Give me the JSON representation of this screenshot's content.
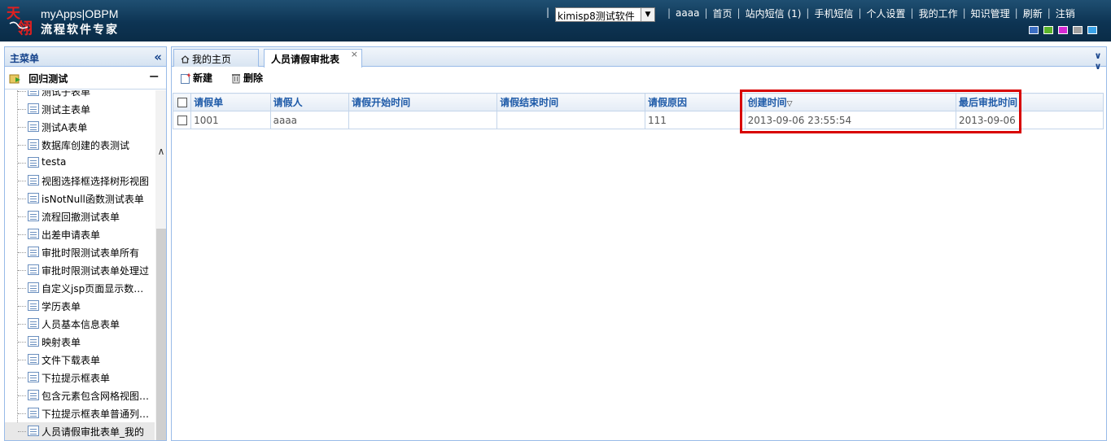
{
  "header": {
    "brand_en": "myApps|OBPM",
    "brand_cn": "流程软件专家",
    "logo_text": "天翎",
    "app_select_value": "kimisp8测试软件",
    "user": "aaaa",
    "links": [
      "首页",
      "站内短信 (1)",
      "手机短信",
      "个人设置",
      "我的工作",
      "知识管理",
      "刷新",
      "注销"
    ],
    "skin_colors": [
      "#3c6fc4",
      "#5ab32b",
      "#d42ad4",
      "#a0a0a0",
      "#3aa3e8"
    ]
  },
  "sidebar": {
    "title": "主菜单",
    "group": "回归测试",
    "items": [
      "测试子表单",
      "测试主表单",
      "测试A表单",
      "数据库创建的表测试",
      "testa",
      "视图选择框选择树形视图",
      "isNotNull函数测试表单",
      "流程回撤测试表单",
      "出差申请表单",
      "审批时限测试表单所有",
      "审批时限测试表单处理过",
      "自定义jsp页面显示数据…",
      "学历表单",
      "人员基本信息表单",
      "映射表单",
      "文件下载表单",
      "下拉提示框表单",
      "包含元素包含网格视图…",
      "下拉提示框表单普通列…",
      "人员请假审批表单_我的"
    ]
  },
  "tabs": {
    "home": "我的主页",
    "active": "人员请假审批表",
    "close": "×"
  },
  "toolbar": {
    "new_label": "新建",
    "delete_label": "删除"
  },
  "table": {
    "columns": [
      "请假单",
      "请假人",
      "请假开始时间",
      "请假结束时间",
      "请假原因",
      "创建时间",
      "最后审批时间"
    ],
    "sort_indicator": "▽",
    "rows": [
      [
        "1001",
        "aaaa",
        "",
        "",
        "111",
        "2013-09-06 23:55:54",
        "2013-09-06"
      ]
    ]
  },
  "colors": {
    "header_bg": "#0d3453",
    "panel_border": "#99bbe8",
    "column_header_text": "#1e5aa8",
    "highlight_border": "#d80000"
  }
}
